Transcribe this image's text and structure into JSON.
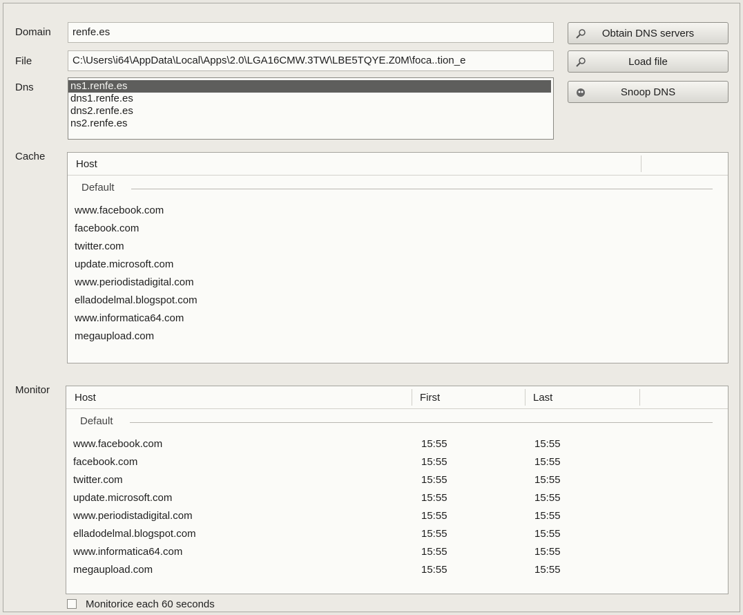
{
  "labels": {
    "domain": "Domain",
    "file": "File",
    "dns": "Dns",
    "cache": "Cache",
    "monitor": "Monitor"
  },
  "domain_value": "renfe.es",
  "file_value": "C:\\Users\\i64\\AppData\\Local\\Apps\\2.0\\LGA16CMW.3TW\\LBE5TQYE.Z0M\\foca..tion_e",
  "buttons": {
    "obtain": "Obtain DNS servers",
    "load": "Load file",
    "snoop": "Snoop DNS"
  },
  "dns_list": [
    "ns1.renfe.es",
    "dns1.renfe.es",
    "dns2.renfe.es",
    "ns2.renfe.es"
  ],
  "dns_selected_index": 0,
  "cache": {
    "header": "Host",
    "group": "Default",
    "hosts": [
      "www.facebook.com",
      "facebook.com",
      "twitter.com",
      "update.microsoft.com",
      "www.periodistadigital.com",
      "elladodelmal.blogspot.com",
      "www.informatica64.com",
      "megaupload.com"
    ]
  },
  "monitor": {
    "headers": {
      "host": "Host",
      "first": "First",
      "last": "Last"
    },
    "group": "Default",
    "rows": [
      {
        "host": "www.facebook.com",
        "first": "15:55",
        "last": "15:55"
      },
      {
        "host": "facebook.com",
        "first": "15:55",
        "last": "15:55"
      },
      {
        "host": "twitter.com",
        "first": "15:55",
        "last": "15:55"
      },
      {
        "host": "update.microsoft.com",
        "first": "15:55",
        "last": "15:55"
      },
      {
        "host": "www.periodistadigital.com",
        "first": "15:55",
        "last": "15:55"
      },
      {
        "host": "elladodelmal.blogspot.com",
        "first": "15:55",
        "last": "15:55"
      },
      {
        "host": "www.informatica64.com",
        "first": "15:55",
        "last": "15:55"
      },
      {
        "host": "megaupload.com",
        "first": "15:55",
        "last": "15:55"
      }
    ]
  },
  "monitor_checkbox_label": "Monitorice each 60 seconds",
  "monitor_checkbox_checked": false,
  "icons": {
    "obtain": "magnifier-icon",
    "load": "magnifier-icon",
    "snoop": "spy-icon"
  }
}
